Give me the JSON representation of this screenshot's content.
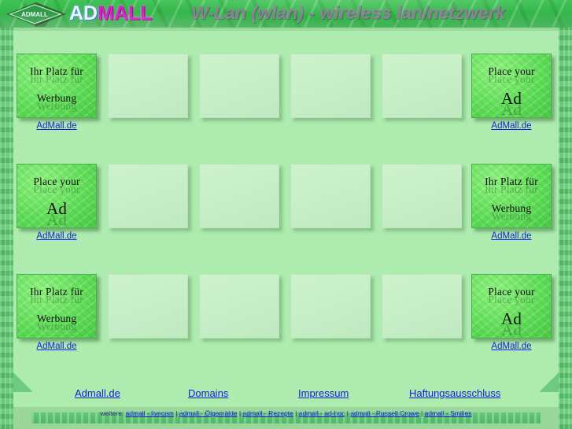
{
  "header": {
    "logo": {
      "badge_text": "ADMALL",
      "word_part1": "AD",
      "word_part2": "MALL"
    },
    "title": "W-Lan (wlan) - wireless lan/netzwerk"
  },
  "ads": {
    "link_label": "AdMall.de",
    "variant_de": {
      "line1": "Ihr Platz für",
      "line2": "Werbung"
    },
    "variant_en": {
      "line1": "Place your",
      "line2": "Ad"
    }
  },
  "grid": {
    "rows": [
      {
        "left_variant": "de",
        "right_variant": "en"
      },
      {
        "left_variant": "en",
        "right_variant": "de"
      },
      {
        "left_variant": "de",
        "right_variant": "en"
      }
    ],
    "empty_cells_per_row": 4
  },
  "footer": {
    "links": [
      {
        "label": "Admall.de"
      },
      {
        "label": "Domains"
      },
      {
        "label": "Impressum"
      },
      {
        "label": "Haftungsausschluss"
      }
    ],
    "sub_lead": "weitere:",
    "sub_links": [
      {
        "label": "admall - livecam"
      },
      {
        "label": "admall - Ölgemälde"
      },
      {
        "label": "admall - Rezepte"
      },
      {
        "label": "admall - ad-hoc"
      },
      {
        "label": "admall - Russell Crowe"
      },
      {
        "label": "admall - Smilies"
      }
    ],
    "separator": "|"
  },
  "colors": {
    "header_green": "#37b84d",
    "panel_green": "#adecae",
    "rail_green": "#5cc570",
    "ad_green": "#5fdc57",
    "link_blue": "#1a1ae0",
    "title_purple": "#8c7d96",
    "logo_magenta": "#d021c8"
  }
}
